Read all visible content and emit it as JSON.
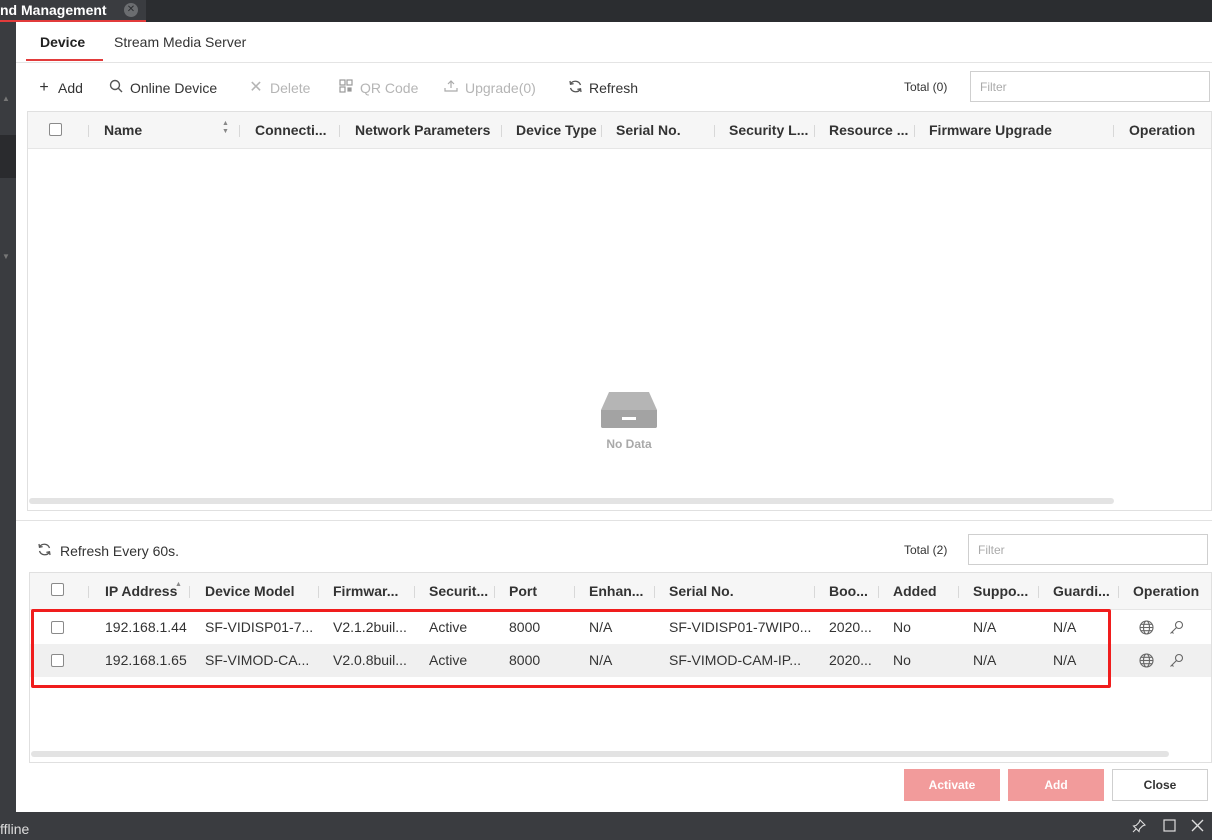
{
  "window": {
    "title": "nd Management",
    "close_glyph": "✕"
  },
  "status_bar": {
    "text": "ffline"
  },
  "tabs": [
    {
      "label": "Device",
      "selected": true
    },
    {
      "label": "Stream Media Server",
      "selected": false
    }
  ],
  "toolbar": {
    "add": "Add",
    "online_device": "Online Device",
    "delete": "Delete",
    "qr_code": "QR Code",
    "upgrade": "Upgrade(0)",
    "refresh": "Refresh",
    "total": "Total (0)",
    "filter_placeholder": "Filter"
  },
  "device_table": {
    "columns": [
      "Name",
      "Connecti...",
      "Network Parameters",
      "Device Type",
      "Serial No.",
      "Security L...",
      "Resource ...",
      "Firmware Upgrade",
      "Operation"
    ],
    "empty_text": "No Data"
  },
  "online": {
    "refresh_text": "Refresh Every 60s.",
    "total": "Total (2)",
    "filter_placeholder": "Filter",
    "columns": [
      "IP Address",
      "Device Model",
      "Firmwar...",
      "Securit...",
      "Port",
      "Enhan...",
      "Serial No.",
      "Boo...",
      "Added",
      "Suppo...",
      "Guardi...",
      "Operation"
    ],
    "rows": [
      [
        "192.168.1.44",
        "SF-VIDISP01-7...",
        "V2.1.2buil...",
        "Active",
        "8000",
        "N/A",
        "SF-VIDISP01-7WIP0...",
        "2020...",
        "No",
        "N/A",
        "N/A"
      ],
      [
        "192.168.1.65",
        "SF-VIMOD-CA...",
        "V2.0.8buil...",
        "Active",
        "8000",
        "N/A",
        "SF-VIMOD-CAM-IP...",
        "2020...",
        "No",
        "N/A",
        "N/A"
      ]
    ]
  },
  "buttons": {
    "activate": "Activate",
    "add": "Add",
    "close": "Close"
  },
  "colors": {
    "accent": "#e23b3b",
    "primary_button": "#f29b9b",
    "highlight": "#f01d1d"
  },
  "icons": {
    "add": "plus-icon",
    "online": "search-icon",
    "delete": "close-icon",
    "qr": "qr-code-icon",
    "upgrade": "upload-icon",
    "refresh": "refresh-icon",
    "web": "globe-icon",
    "config": "key-icon"
  }
}
